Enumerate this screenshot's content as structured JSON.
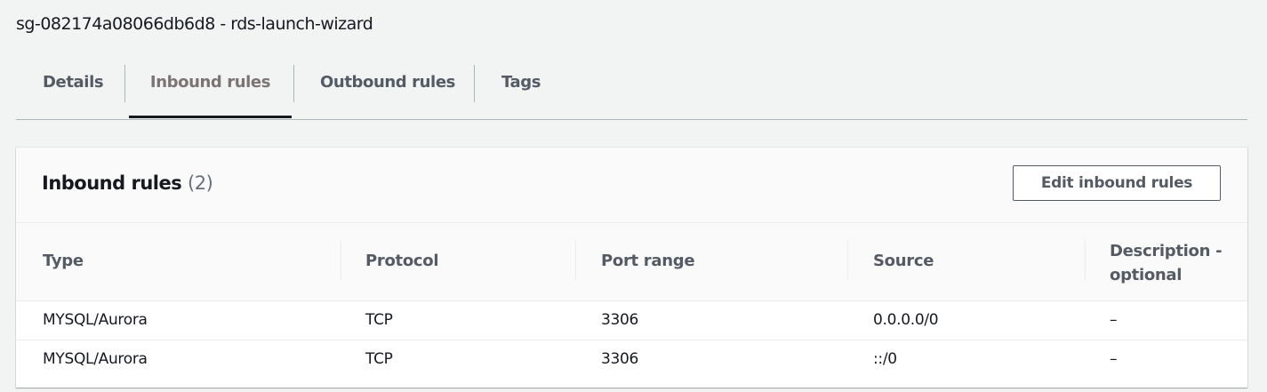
{
  "header": {
    "title": "sg-082174a08066db6d8 - rds-launch-wizard"
  },
  "tabs": [
    {
      "label": "Details"
    },
    {
      "label": "Inbound rules",
      "active": true
    },
    {
      "label": "Outbound rules"
    },
    {
      "label": "Tags"
    }
  ],
  "panel": {
    "title": "Inbound rules",
    "count": "(2)",
    "edit_button": "Edit inbound rules"
  },
  "table": {
    "columns": [
      "Type",
      "Protocol",
      "Port range",
      "Source",
      "Description - optional"
    ],
    "rows": [
      [
        "MYSQL/Aurora",
        "TCP",
        "3306",
        "0.0.0.0/0",
        "–"
      ],
      [
        "MYSQL/Aurora",
        "TCP",
        "3306",
        "::/0",
        "–"
      ]
    ]
  }
}
